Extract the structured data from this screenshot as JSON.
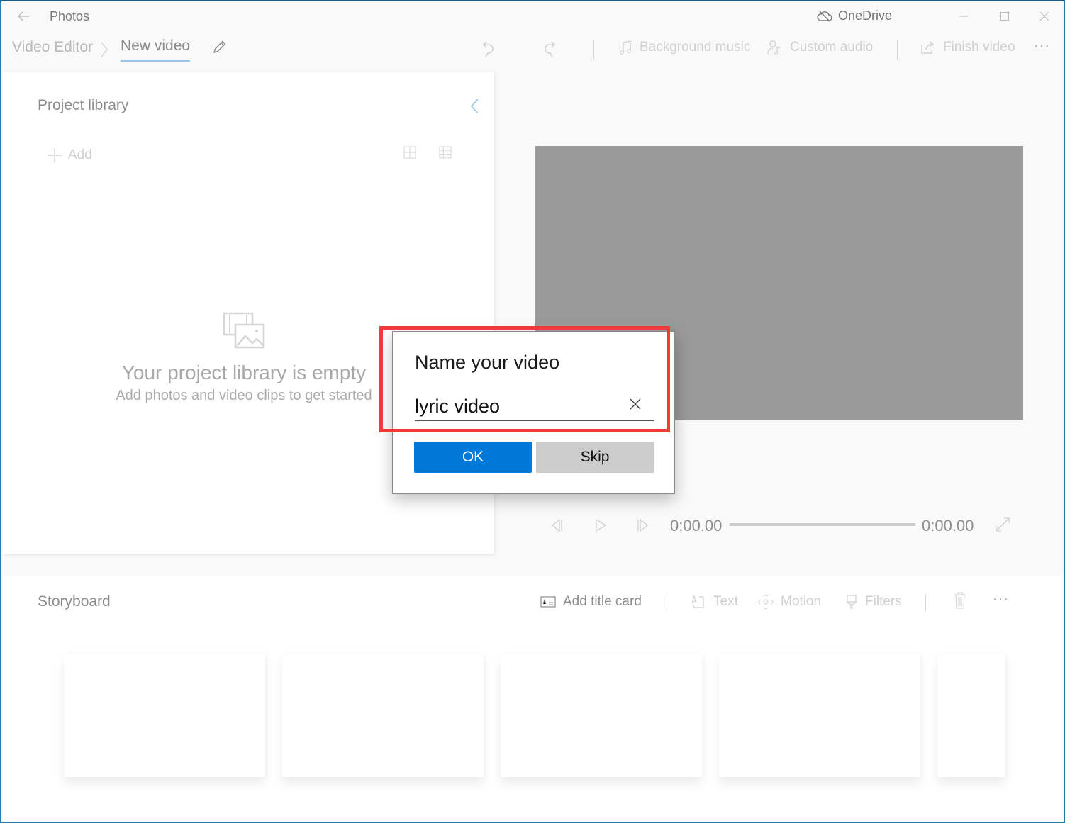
{
  "window": {
    "app_title": "Photos",
    "onedrive_label": "OneDrive",
    "border_color": "#2b7ba3"
  },
  "breadcrumb": {
    "root": "Video Editor",
    "current": "New video"
  },
  "toolbar": {
    "undo_icon": "undo-icon",
    "redo_icon": "redo-icon",
    "background_music": "Background music",
    "custom_audio": "Custom audio",
    "finish_video": "Finish video",
    "more": "···"
  },
  "library": {
    "title": "Project library",
    "add_label": "Add",
    "empty_title": "Your project library is empty",
    "empty_subtitle": "Add photos and video clips to get started"
  },
  "player": {
    "current_time": "0:00.00",
    "total_time": "0:00.00",
    "progress": 0
  },
  "storyboard": {
    "title": "Storyboard",
    "add_title_card": "Add title card",
    "text": "Text",
    "motion": "Motion",
    "filters": "Filters",
    "more": "···",
    "slots": [
      {},
      {},
      {},
      {},
      {}
    ]
  },
  "dialog": {
    "title": "Name your video",
    "input_value": "lyric video",
    "ok_label": "OK",
    "skip_label": "Skip",
    "accent_color": "#0078d7",
    "highlight_color": "#f13b3b"
  }
}
